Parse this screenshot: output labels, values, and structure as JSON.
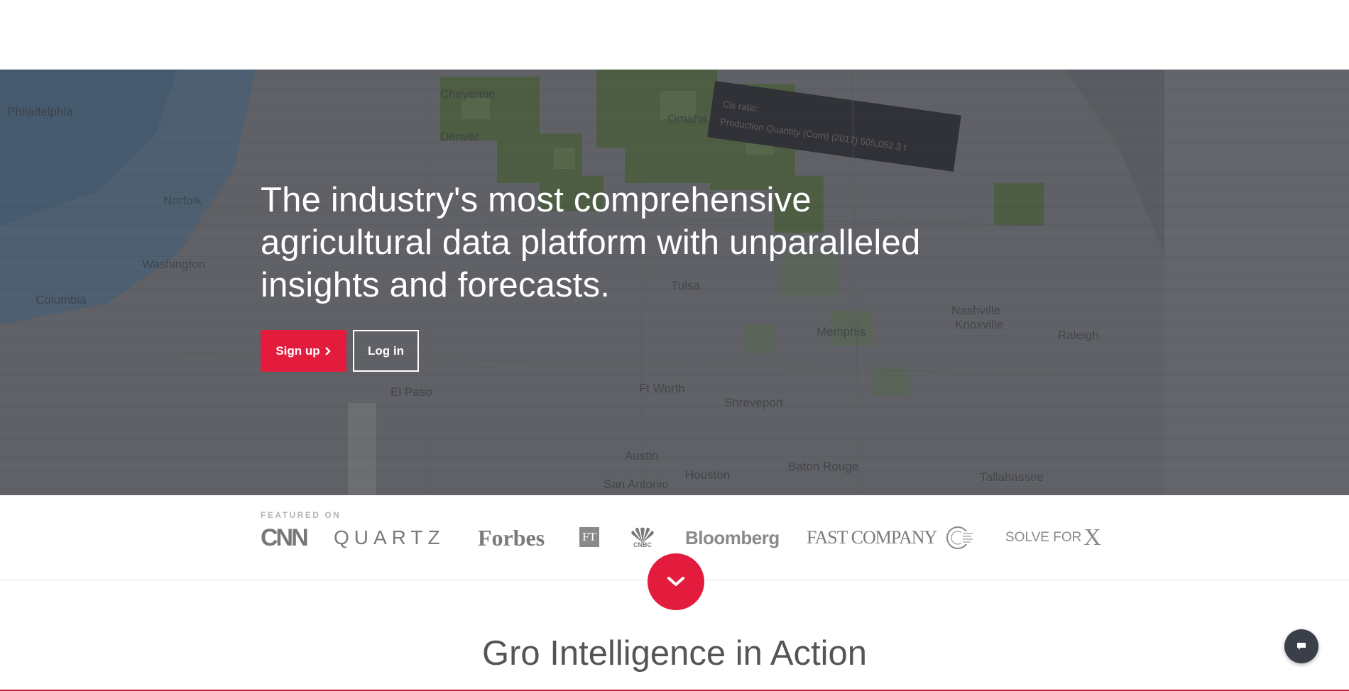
{
  "hero": {
    "title": "The industry's most comprehensive agricultural data platform with unparalleled insights and forecasts.",
    "signup_label": "Sign up",
    "login_label": "Log in",
    "map_labels": [
      "Cheyenne",
      "Denver",
      "Omaha",
      "Tulsa",
      "Nashville",
      "Knoxville",
      "Memphis",
      "Ft Worth",
      "Shreveport",
      "El Paso",
      "Austin",
      "Houston",
      "Baton Rouge",
      "San Antonio",
      "Philadelphia",
      "Washington",
      "Norfolk",
      "Columbia",
      "Tallahassee",
      "Raleigh"
    ],
    "tooltip_title": "Cls ratio:",
    "tooltip_value": "Production Quantity (Corn) (2017) 505,052.3 t"
  },
  "featured": {
    "label": "FEATURED ON",
    "logos": {
      "cnn": "CNN",
      "quartz": "QUARTZ",
      "forbes": "Forbes",
      "ft": "FT",
      "cnbc": "CNBC",
      "bloomberg": "Bloomberg",
      "fastcompany": "FAST COMPANY",
      "solve_for": "SOLVE FOR",
      "solve_x": "X"
    }
  },
  "section": {
    "title": "Gro Intelligence in Action"
  },
  "colors": {
    "accent": "#e31c3d",
    "hero_overlay": "#3c3c44",
    "chat_button": "#3a3f4a"
  },
  "icons": {
    "signup_chevron": "chevron-right-icon",
    "scroll_down": "chevron-down-icon",
    "chat": "chat-bubble-icon"
  }
}
